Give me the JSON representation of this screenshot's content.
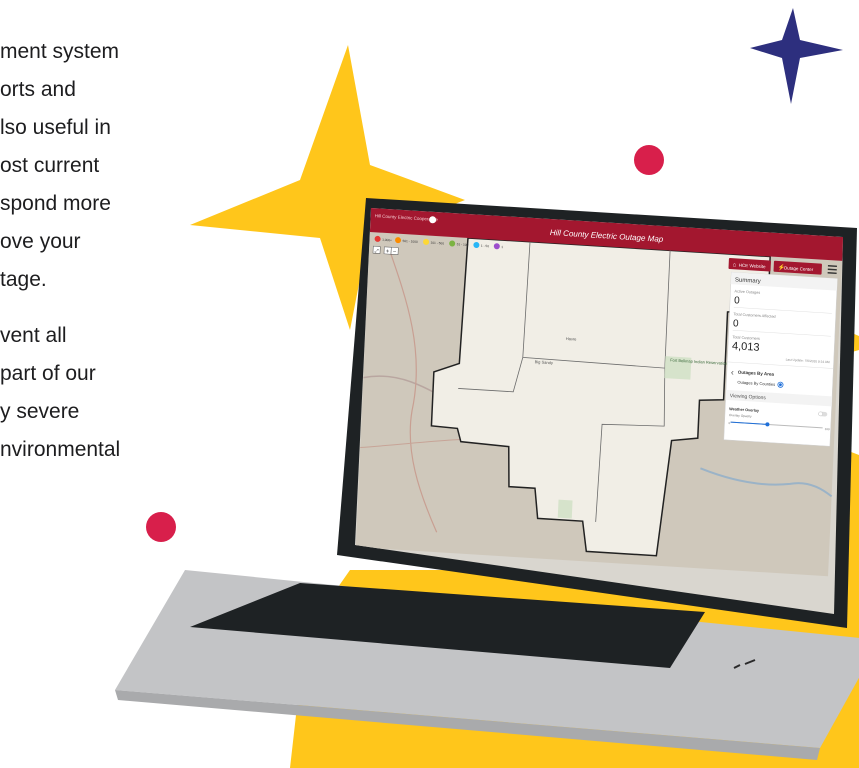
{
  "colors": {
    "accent_yellow": "#FFC61B",
    "accent_navy": "#2D2F7E",
    "accent_red": "#D81F4B",
    "header_bar": "#A3172F",
    "laptop_body": "#C3C4C6",
    "laptop_bezel": "#1E2224"
  },
  "copy": {
    "lines": [
      "ment system",
      "orts and",
      "lso useful in",
      "ost current",
      "spond more",
      "ove your",
      "tage.",
      "vent all",
      "part of our",
      "y severe",
      "nvironmental"
    ]
  },
  "app": {
    "title": "Hill County Electric Outage Map",
    "logo_text": "Hill County Electric Cooperative",
    "legend": [
      "1,000+",
      "501 - 1000",
      "101 - 500",
      "51 - 100",
      "1 - 50",
      "1"
    ],
    "legend_colors": [
      "#E53935",
      "#FB8C00",
      "#FDD835",
      "#7CB342",
      "#29B6F6",
      "#9C4DCC"
    ],
    "map_tools": [
      "zoom-extent",
      "zoom-in",
      "zoom-out"
    ],
    "buttons": {
      "website": "HCE Website",
      "outage_center": "Outage Center"
    },
    "summary": {
      "title": "Summary",
      "active_outages_label": "Active Outages",
      "active_outages_value": "0",
      "customers_affected_label": "Total Customers Affected",
      "customers_affected_value": "0",
      "total_customers_label": "Total Customers",
      "total_customers_value": "4,013",
      "last_update": "Last Update: 7/6/2020 9:14 AM"
    },
    "outages_by_area": {
      "title": "Outages By Area",
      "option": "Outages By Counties"
    },
    "viewing_options": {
      "title": "Viewing Options",
      "weather_label": "Weather Overlay",
      "opacity_label": "Overlay Opacity",
      "slider_min": "0",
      "slider_max": "100",
      "opacity_level": 0.4
    },
    "map_labels": [
      "Fort Belknap Indian Reservation",
      "Havre",
      "Big Sandy"
    ]
  }
}
